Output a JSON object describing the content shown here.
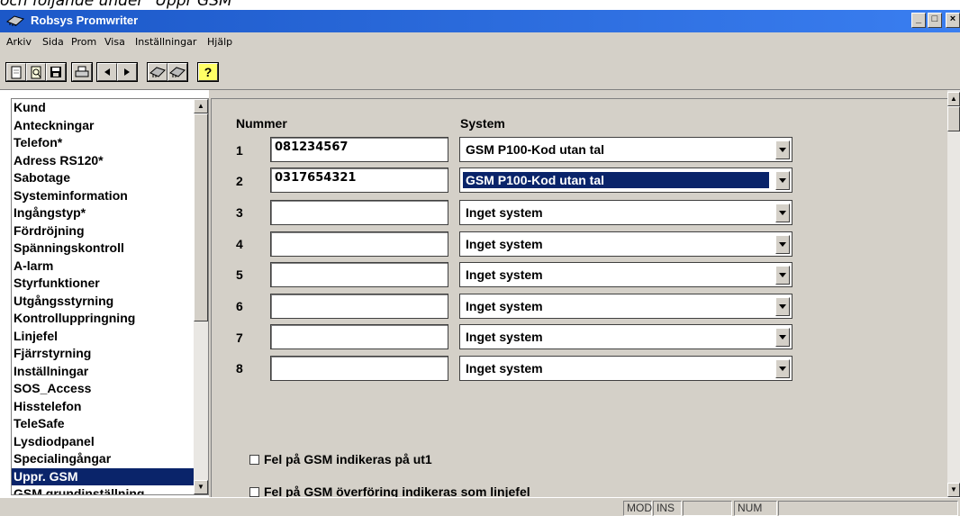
{
  "caption": "och följande under \"Uppr GSM\"",
  "window": {
    "title": "Robsys Promwriter",
    "buttons": {
      "minimize": "_",
      "maximize": "□",
      "close": "×"
    }
  },
  "menu": {
    "items": [
      {
        "label": "Arkiv"
      },
      {
        "label": "Sida"
      },
      {
        "label": "Prom"
      },
      {
        "label": "Visa"
      },
      {
        "label": "Inställningar"
      },
      {
        "label": "Hjälp"
      }
    ]
  },
  "toolbar": {
    "buttons": [
      {
        "icon": "new-file-icon"
      },
      {
        "icon": "open-icon"
      },
      {
        "icon": "save-icon"
      },
      {
        "icon": "print-icon"
      },
      {
        "icon": "prev-arrow-icon"
      },
      {
        "icon": "next-arrow-icon"
      },
      {
        "icon": "read-chip-icon"
      },
      {
        "icon": "write-chip-icon"
      },
      {
        "icon": "help-icon",
        "label": "?"
      }
    ]
  },
  "sidebar": {
    "items": [
      {
        "label": "Kund"
      },
      {
        "label": "Anteckningar"
      },
      {
        "label": "Telefon*"
      },
      {
        "label": "Adress RS120*"
      },
      {
        "label": "Sabotage"
      },
      {
        "label": "Systeminformation"
      },
      {
        "label": "Ingångstyp*"
      },
      {
        "label": "Fördröjning"
      },
      {
        "label": "Spänningskontroll"
      },
      {
        "label": "A-larm"
      },
      {
        "label": "Styrfunktioner"
      },
      {
        "label": "Utgångsstyrning"
      },
      {
        "label": "Kontrolluppringning"
      },
      {
        "label": "Linjefel"
      },
      {
        "label": "Fjärrstyrning"
      },
      {
        "label": "Inställningar"
      },
      {
        "label": "SOS_Access"
      },
      {
        "label": "Hisstelefon"
      },
      {
        "label": "TeleSafe"
      },
      {
        "label": "Lysdiodpanel"
      },
      {
        "label": "Specialingångar"
      },
      {
        "label": "Uppr. GSM",
        "selected": true
      },
      {
        "label": "GSM grundinställning"
      }
    ]
  },
  "main": {
    "headers": {
      "number": "Nummer",
      "system": "System"
    },
    "rows": [
      {
        "index": "1",
        "number": "081234567",
        "system": "GSM P100-Kod utan tal"
      },
      {
        "index": "2",
        "number": "0317654321",
        "system": "GSM P100-Kod utan tal",
        "focused": true
      },
      {
        "index": "3",
        "number": "",
        "system": "Inget system"
      },
      {
        "index": "4",
        "number": "",
        "system": "Inget system"
      },
      {
        "index": "5",
        "number": "",
        "system": "Inget system"
      },
      {
        "index": "6",
        "number": "",
        "system": "Inget system"
      },
      {
        "index": "7",
        "number": "",
        "system": "Inget system"
      },
      {
        "index": "8",
        "number": "",
        "system": "Inget system"
      }
    ],
    "checkboxes": [
      {
        "label": "Fel på GSM indikeras på ut1",
        "checked": false
      },
      {
        "label": "Fel på GSM överföring indikeras som linjefel",
        "checked": false
      }
    ]
  },
  "statusbar": {
    "panes": [
      {
        "label": "MOD"
      },
      {
        "label": "INS"
      },
      {
        "label": ""
      },
      {
        "label": "NUM"
      },
      {
        "label": ""
      }
    ]
  },
  "colors": {
    "titlebar": "#1c58c8",
    "selection": "#0a246a",
    "face": "#d4d0c8"
  }
}
